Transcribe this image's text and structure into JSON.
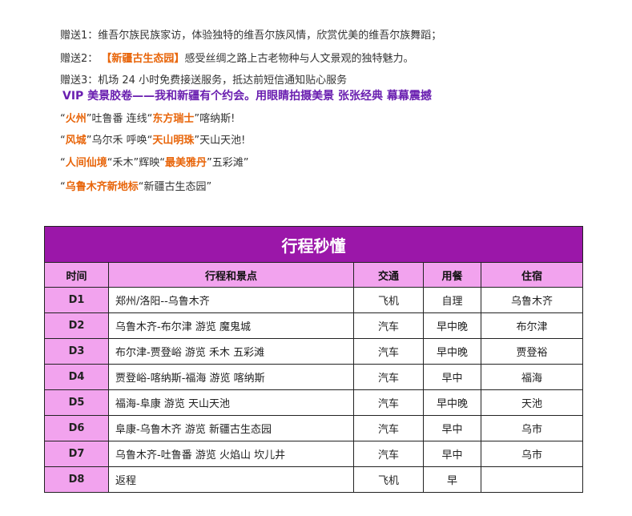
{
  "gifts": {
    "g1_label": "赠送1：",
    "g1_text": "维吾尔族民族家访，体验独特的维吾尔族风情，欣赏优美的维吾尔族舞蹈；",
    "g2_label": "赠送2：",
    "g2_highlight": "【新疆古生态园】",
    "g2_text": "感受丝绸之路上古老物种与人文景观的独特魅力。",
    "g3_label": "赠送3：",
    "g3_text": "机场 24 小时免费接送服务，抵达前短信通知贴心服务"
  },
  "vip_line": "VIP 美景胶卷——我和新疆有个约会。用眼睛拍摄美景  张张经典 幕幕震撼",
  "quotes": [
    {
      "open": "“",
      "hl1": "火州",
      "mid1": "”吐鲁番 连线“",
      "hl2": "东方瑞士",
      "tail": "”喀纳斯!"
    },
    {
      "open": "“",
      "hl1": "风城",
      "mid1": "”乌尔禾 呼唤“",
      "hl2": "天山明珠",
      "tail": "”天山天池!"
    },
    {
      "open": "“",
      "hl1": "人间仙境",
      "mid1": "“禾木”辉映“",
      "hl2": "最美雅丹",
      "tail": "”五彩滩”"
    },
    {
      "open": "“",
      "hl1": "乌鲁木齐新地标",
      "tail": "“新疆古生态园”"
    }
  ],
  "table": {
    "title": "行程秒懂",
    "headers": [
      "时间",
      "行程和景点",
      "交通",
      "用餐",
      "住宿"
    ],
    "rows": [
      [
        "D1",
        "郑州/洛阳--乌鲁木齐",
        "飞机",
        "自理",
        "乌鲁木齐"
      ],
      [
        "D2",
        "乌鲁木齐-布尔津   游览 魔鬼城",
        "汽车",
        "早中晚",
        "布尔津"
      ],
      [
        "D3",
        "布尔津-贾登峪   游览 禾木   五彩滩",
        "汽车",
        "早中晚",
        "贾登裕"
      ],
      [
        "D4",
        "贾登峪-喀纳斯-福海 游览  喀纳斯",
        "汽车",
        "早中",
        "福海"
      ],
      [
        "D5",
        "福海-阜康    游览 天山天池",
        "汽车",
        "早中晚",
        "天池"
      ],
      [
        "D6",
        "阜康-乌鲁木齐   游览 新疆古生态园",
        "汽车",
        "早中",
        "乌市"
      ],
      [
        "D7",
        "乌鲁木齐-吐鲁番 游览 火焰山 坎儿井",
        "汽车",
        "早中",
        "乌市"
      ],
      [
        "D8",
        "返程",
        "飞机",
        "早",
        ""
      ]
    ]
  }
}
